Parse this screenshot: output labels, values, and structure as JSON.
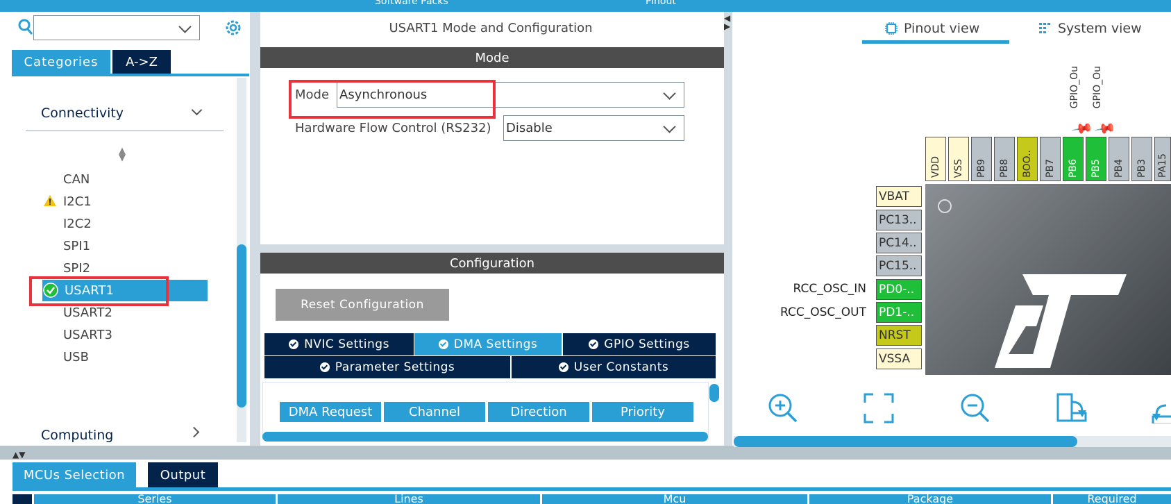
{
  "topbar": {
    "left_label": "Software Packs",
    "right_label": "Pinout"
  },
  "left_panel": {
    "tabs": {
      "categories": "Categories",
      "az": "A->Z"
    },
    "category": "Connectivity",
    "peripherals": [
      "CAN",
      "I2C1",
      "I2C2",
      "SPI1",
      "SPI2",
      "USART1",
      "USART2",
      "USART3",
      "USB"
    ],
    "next_category": "Computing"
  },
  "mode_panel": {
    "title": "USART1 Mode and Configuration",
    "mode_header": "Mode",
    "mode_label": "Mode",
    "mode_value": "Asynchronous",
    "hw_flow_label": "Hardware Flow Control (RS232)",
    "hw_flow_value": "Disable"
  },
  "config_panel": {
    "header": "Configuration",
    "reset_button": "Reset Configuration",
    "tabs": [
      "NVIC Settings",
      "DMA Settings",
      "GPIO Settings",
      "Parameter Settings",
      "User Constants"
    ],
    "dma_columns": [
      "DMA Request",
      "Channel",
      "Direction",
      "Priority"
    ]
  },
  "pinout": {
    "tabs": {
      "pinout_view": "Pinout view",
      "system_view": "System view"
    },
    "top_pins": [
      "VDD",
      "VSS",
      "PB9",
      "PB8",
      "BOO..",
      "PB7",
      "PB6",
      "PB5",
      "PB4",
      "PB3",
      "PA15"
    ],
    "pin_labels_top": [
      "GPIO_Ou",
      "GPIO_Ou"
    ],
    "left_pins": [
      "VBAT",
      "PC13..",
      "PC14..",
      "PC15..",
      "PD0-..",
      "PD1-..",
      "NRST",
      "VSSA"
    ],
    "signals": [
      "RCC_OSC_IN",
      "RCC_OSC_OUT"
    ]
  },
  "bottom": {
    "tabs": [
      "MCUs Selection",
      "Output"
    ],
    "table_headers": [
      "Series",
      "Lines",
      "Mcu",
      "Package",
      "Required"
    ]
  },
  "colors": {
    "accent": "#2a9fd6",
    "navy": "#03234b",
    "green_pin": "#1fbf3a",
    "olive_pin": "#c5c91a",
    "highlight_red": "#e8323c"
  }
}
